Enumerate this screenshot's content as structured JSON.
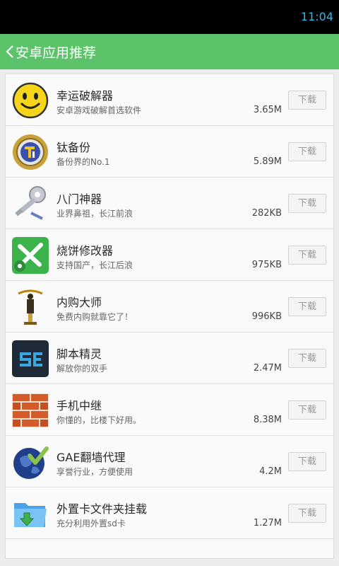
{
  "status_bar": {
    "time": "11:04"
  },
  "header": {
    "title": "安卓应用推荐"
  },
  "apps": [
    {
      "name": "幸运破解器",
      "desc": "安卓游戏破解首选软件",
      "size": "3.65M",
      "button": "下载",
      "icon": "lucky-patcher-smiley-icon"
    },
    {
      "name": "钛备份",
      "desc": "备份界的No.1",
      "size": "5.89M",
      "button": "下载",
      "icon": "titanium-backup-icon"
    },
    {
      "name": "八门神器",
      "desc": "业界鼻祖，长江前浪",
      "size": "282KB",
      "button": "下载",
      "icon": "key-wrench-icon"
    },
    {
      "name": "烧饼修改器",
      "desc": "支持国产，长江后浪",
      "size": "975KB",
      "button": "下载",
      "icon": "wrench-gear-icon"
    },
    {
      "name": "内购大师",
      "desc": "免费内购就靠它了！",
      "size": "996KB",
      "button": "下载",
      "icon": "statue-icon"
    },
    {
      "name": "脚本精灵",
      "desc": "解放你的双手",
      "size": "2.47M",
      "button": "下载",
      "icon": "script-se-icon"
    },
    {
      "name": "手机中继",
      "desc": "你懂的，比楼下好用。",
      "size": "8.38M",
      "button": "下载",
      "icon": "brick-wall-icon"
    },
    {
      "name": "GAE翻墙代理",
      "desc": "享誉行业，方便使用",
      "size": "4.2M",
      "button": "下载",
      "icon": "globe-check-icon"
    },
    {
      "name": "外置卡文件夹挂载",
      "desc": "充分利用外置sd卡",
      "size": "1.27M",
      "button": "下载",
      "icon": "folder-download-icon"
    }
  ],
  "colors": {
    "header_bg": "#5cc36a",
    "clock": "#33b5e5"
  }
}
